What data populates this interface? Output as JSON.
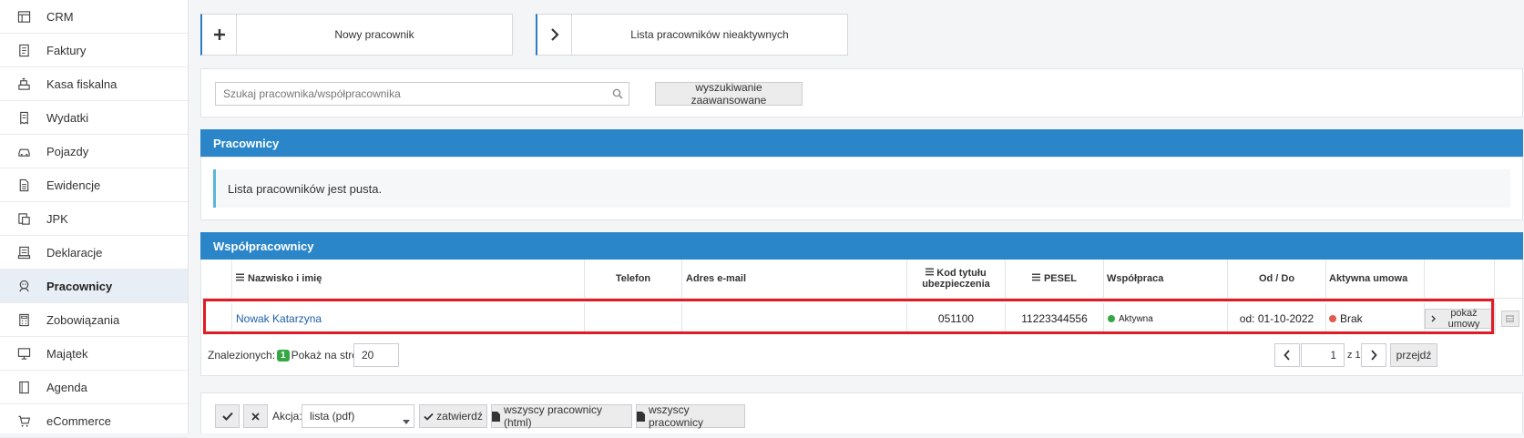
{
  "sidebar": {
    "items": [
      {
        "label": "CRM",
        "icon": "table-icon"
      },
      {
        "label": "Faktury",
        "icon": "invoice-icon"
      },
      {
        "label": "Kasa fiskalna",
        "icon": "cash-register-icon"
      },
      {
        "label": "Wydatki",
        "icon": "receipt-icon"
      },
      {
        "label": "Pojazdy",
        "icon": "car-icon"
      },
      {
        "label": "Ewidencje",
        "icon": "document-icon"
      },
      {
        "label": "JPK",
        "icon": "files-icon"
      },
      {
        "label": "Deklaracje",
        "icon": "declaration-icon"
      },
      {
        "label": "Pracownicy",
        "icon": "employees-icon",
        "active": true
      },
      {
        "label": "Zobowiązania",
        "icon": "calculator-icon"
      },
      {
        "label": "Majątek",
        "icon": "monitor-icon"
      },
      {
        "label": "Agenda",
        "icon": "book-icon"
      },
      {
        "label": "eCommerce",
        "icon": "cart-icon"
      }
    ]
  },
  "top": {
    "new_employee": "Nowy pracownik",
    "inactive_list": "Lista pracowników nieaktywnych"
  },
  "search": {
    "placeholder": "Szukaj pracownika/współpracownika",
    "advanced": "wyszukiwanie zaawansowane"
  },
  "employees": {
    "header": "Pracownicy",
    "empty_message": "Lista pracowników jest pusta."
  },
  "coworkers": {
    "header": "Współpracownicy",
    "columns": {
      "name": "Nazwisko i imię",
      "phone": "Telefon",
      "email": "Adres e-mail",
      "insurance_code_1": "Kod tytułu",
      "insurance_code_2": "ubezpieczenia",
      "pesel": "PESEL",
      "cooperation": "Współpraca",
      "from_to": "Od / Do",
      "active_contract": "Aktywna umowa"
    },
    "rows": [
      {
        "name": "Nowak Katarzyna",
        "phone": "",
        "email": "",
        "insurance_code": "051100",
        "pesel": "11223344556",
        "cooperation": "Aktywna",
        "from_to": "od: 01-10-2022",
        "active_contract": "Brak",
        "show_contract": "pokaż umowy"
      }
    ],
    "status_colors": {
      "active": "#35a845",
      "none": "#e05a4e"
    }
  },
  "pagination": {
    "found_label": "Znalezionych:",
    "found_count": "1",
    "per_page_label": "Pokaż na stronie:",
    "per_page": "20",
    "page": "1",
    "of_label": "z 1",
    "go": "przejdź"
  },
  "actions": {
    "action_label": "Akcja:",
    "selected_action": "lista (pdf)",
    "confirm": "zatwierdź",
    "all_html": "wszyscy pracownicy (html)",
    "all": "wszyscy pracownicy"
  },
  "colors": {
    "section_header": "#2a86c9",
    "highlight": "#e01b24",
    "link": "#1f5fa8"
  }
}
